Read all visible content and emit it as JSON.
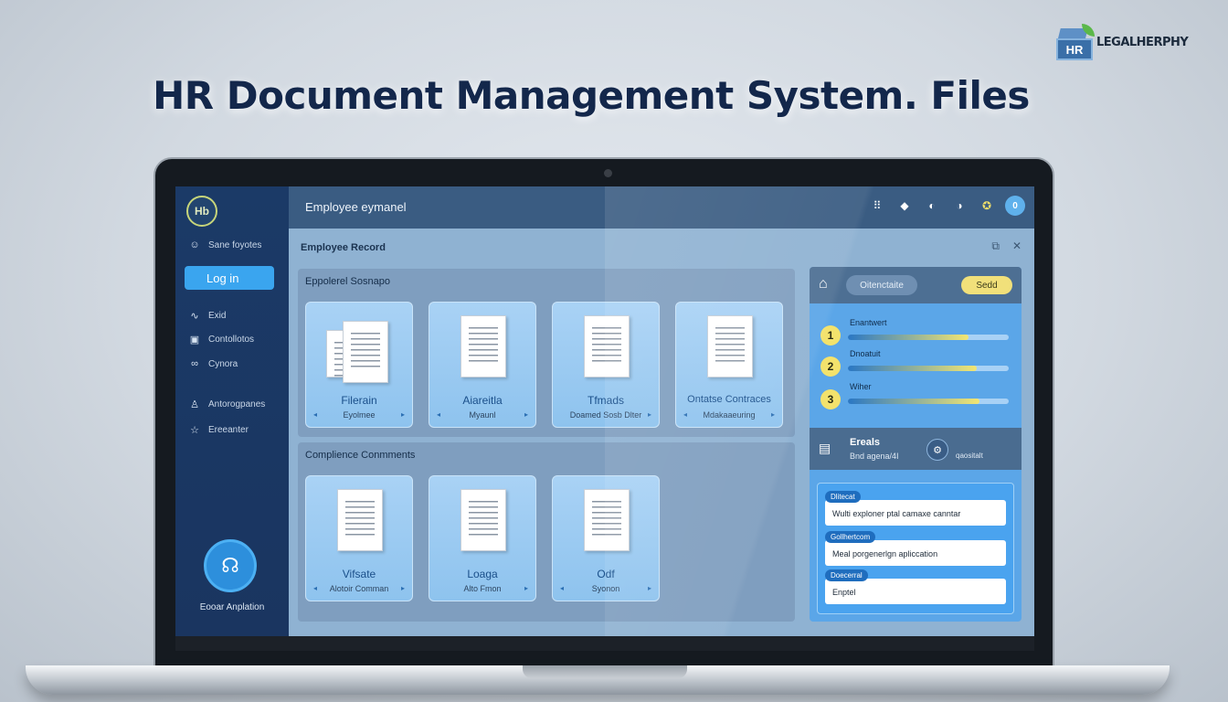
{
  "headline": "HR Document Management System. Files",
  "brand": {
    "logo_text": "HR",
    "name": "LEGALHERPHY"
  },
  "sidebar": {
    "logo_text": "Hb",
    "items": [
      {
        "icon": "user-icon",
        "glyph": "☺",
        "label": "Sane foyotes"
      },
      {
        "icon": "login-icon",
        "glyph": "",
        "label": "Log in",
        "active": true
      },
      {
        "icon": "chart-icon",
        "glyph": "∿",
        "label": "Exid"
      },
      {
        "icon": "folder-icon",
        "glyph": "▣",
        "label": "Contollotos"
      },
      {
        "icon": "link-icon",
        "glyph": "∞",
        "label": "Cynora"
      },
      {
        "icon": "person-icon",
        "glyph": "♙",
        "label": "Antorogpanes"
      },
      {
        "icon": "star-icon",
        "glyph": "☆",
        "label": "Ereeanter"
      }
    ],
    "fab_label": "Eooar Anplation"
  },
  "topbar": {
    "title": "Employee eymanel",
    "icons": [
      "grid-icon",
      "diamond-icon",
      "globe-icon",
      "toggle-icon",
      "badge-icon",
      "avatar-icon"
    ]
  },
  "record": {
    "title": "Employee Record"
  },
  "section1": {
    "title": "Eppolerel Sosnapo",
    "cards": [
      {
        "name": "Filerain",
        "sub": "Eyolmee"
      },
      {
        "name": "Aiareitla",
        "sub": "Myaunl"
      },
      {
        "name": "Tfmads",
        "sub": "Doamed Sosb Dlter"
      },
      {
        "name": "Ontatse Contraces",
        "sub": "Mdakaaeuring"
      }
    ]
  },
  "section2": {
    "title": "Complience Conmments",
    "cards": [
      {
        "name": "Vifsate",
        "sub": "Alotoir Comman"
      },
      {
        "name": "Loaga",
        "sub": "Alto Fmon"
      },
      {
        "name": "Odf",
        "sub": "Syonon"
      }
    ]
  },
  "right_panel": {
    "search_label": "Oitenctaite",
    "button_label": "Sedd",
    "steps": [
      {
        "num": "1",
        "label": "Enantwert",
        "progress": 0.75
      },
      {
        "num": "2",
        "label": "Dnoatuit",
        "progress": 0.8
      },
      {
        "num": "3",
        "label": "Wiher",
        "progress": 0.82
      }
    ],
    "profile": {
      "name": "Ereals",
      "sub": "Bnd agena/4I",
      "status": "qaositalt"
    },
    "notes": [
      {
        "tag": "Dlitecat",
        "text": "Wulti exploner ptal camaxe canntar"
      },
      {
        "tag": "Gollhertcom",
        "text": "Meal porgenerlgn apliccation"
      },
      {
        "tag": "Doecerral",
        "text": "Enptel"
      }
    ]
  },
  "colors": {
    "accent": "#3aa5ef",
    "sidebar": "#1b3a67",
    "highlight": "#f3e26c",
    "headline": "#13274b"
  }
}
